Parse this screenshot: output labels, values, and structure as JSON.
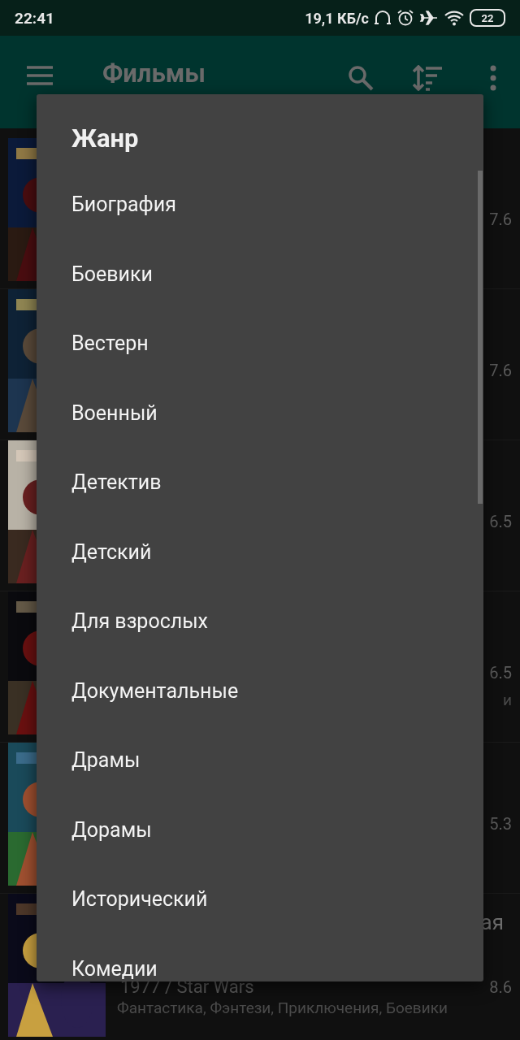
{
  "status_bar": {
    "time": "22:41",
    "net_speed": "19,1 КБ/с",
    "battery": "22"
  },
  "toolbar": {
    "title": "Фильмы"
  },
  "movies": [
    {
      "rating": "7.6"
    },
    {
      "rating": "7.6"
    },
    {
      "rating": "6.5"
    },
    {
      "rating": "6.5",
      "genres": "и"
    },
    {
      "rating": "5.3"
    },
    {
      "title": "ая",
      "year": "1977 / Star Wars",
      "rating": "8.6",
      "genres": "Фантастика, Фэнтези, Приключения, Боевики"
    }
  ],
  "dialog": {
    "title": "Жанр",
    "items": [
      "Биография",
      "Боевики",
      "Вестерн",
      "Военный",
      "Детектив",
      "Детский",
      "Для взрослых",
      "Документальные",
      "Драмы",
      "Дорамы",
      "Исторический",
      "Комедии"
    ]
  }
}
